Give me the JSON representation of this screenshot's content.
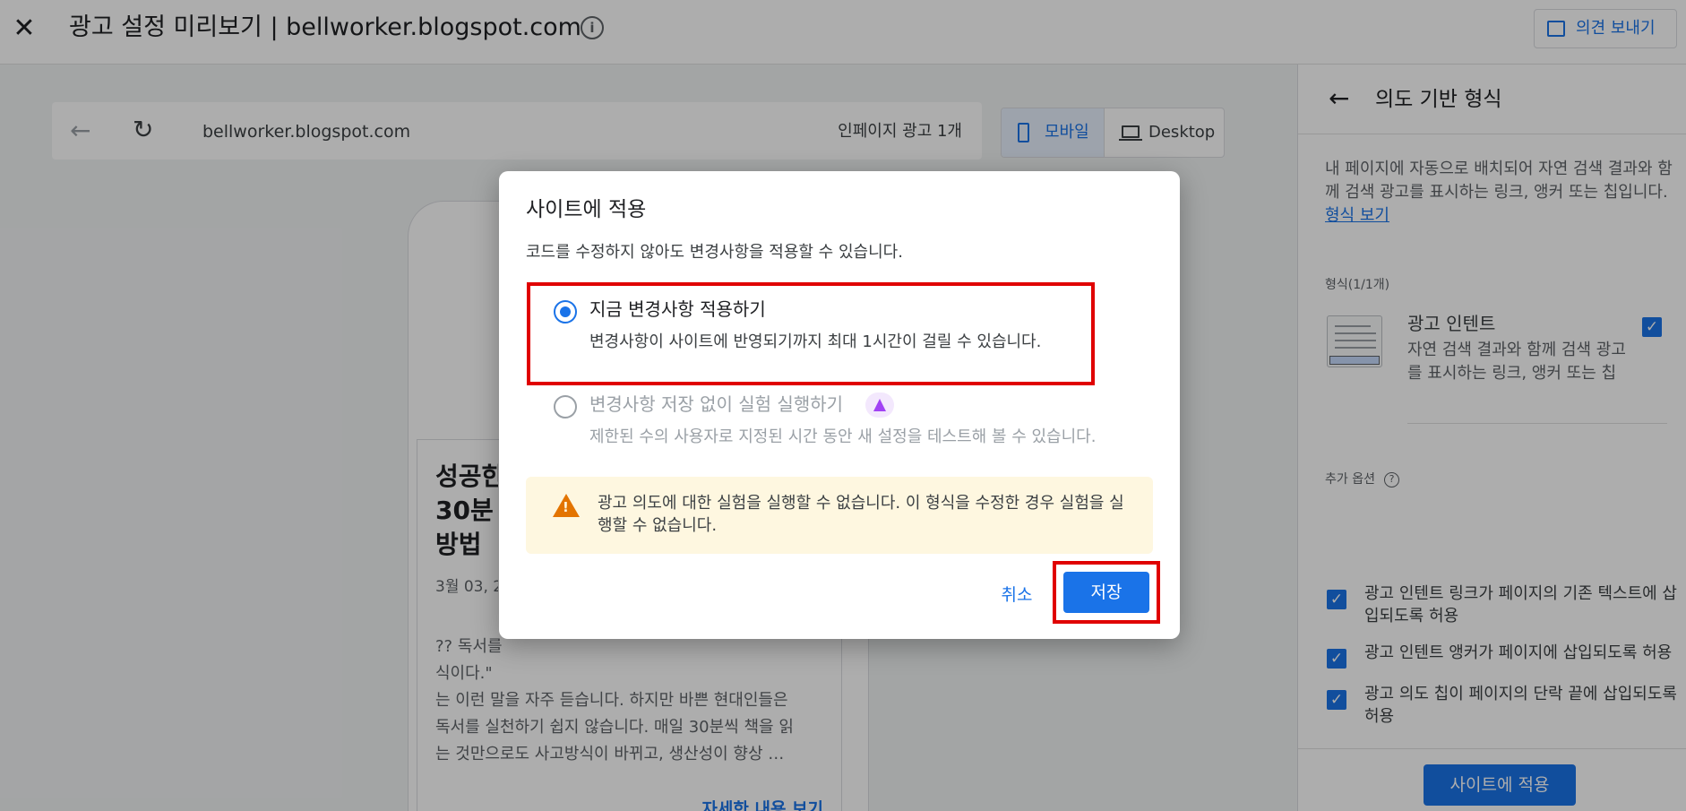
{
  "header": {
    "title": "광고 설정 미리보기 | bellworker.blogspot.com",
    "feedback_label": "의견 보내기"
  },
  "preview": {
    "url": "bellworker.blogspot.com",
    "inpage_ads": "인페이지 광고 1개",
    "device_mobile": "모바일",
    "device_desktop": "Desktop",
    "article": {
      "title_lines": [
        "성공한",
        "30분",
        "방법"
      ],
      "date": "3월 03, 2",
      "body_lines": [
        "?? 독서를",
        "식이다.\"",
        "는 이런 말을 자주 듣습니다. 하지만 바쁜 현대인들은",
        "독서를 실천하기 쉽지 않습니다. 매일 30분씩 책을 읽",
        "는 것만으로도 사고방식이 바뀌고, 생산성이 향상 …"
      ],
      "more_link": "자세한 내용 보기"
    }
  },
  "panel": {
    "title": "의도 기반 형식",
    "description": "내 페이지에 자동으로 배치되어 자연 검색 결과와 함께 검색 광고를 표시하는 링크, 앵커 또는 칩입니다.",
    "description_link": "형식 보기",
    "formats_label": "형식(1/1개)",
    "format_name": "광고 인텐트",
    "format_desc": "자연 검색 결과와 함께 검색 광고를 표시하는 링크, 앵커 또는 칩",
    "extra_label": "추가 옵션",
    "options": [
      {
        "line1": "광고 인텐트 링크가 페이지의 기존 텍스트에 삽",
        "line2": "입되도록 허용"
      },
      {
        "line1": "광고 인텐트 앵커가 페이지에 삽입되도록 허용",
        "line2": ""
      },
      {
        "line1": "광고 의도 칩이 페이지의 단락 끝에 삽입되도록",
        "line2": "허용"
      }
    ],
    "apply_label": "사이트에 적용"
  },
  "dialog": {
    "title": "사이트에 적용",
    "subtitle": "코드를 수정하지 않아도 변경사항을 적용할 수 있습니다.",
    "option1_label": "지금 변경사항 적용하기",
    "option1_desc": "변경사항이 사이트에 반영되기까지 최대 1시간이 걸릴 수 있습니다.",
    "option2_label": "변경사항 저장 없이 실험 실행하기",
    "option2_desc": "제한된 수의 사용자로 지정된 시간 동안 새 설정을 테스트해 볼 수 있습니다.",
    "warning": "광고 의도에 대한 실험을 실행할 수 없습니다. 이 형식을 수정한 경우 실험을 실행할 수 없습니다.",
    "cancel_label": "취소",
    "save_label": "저장"
  },
  "colors": {
    "accent": "#1a73e8",
    "highlight": "#e00000",
    "warning": "#e37400"
  }
}
